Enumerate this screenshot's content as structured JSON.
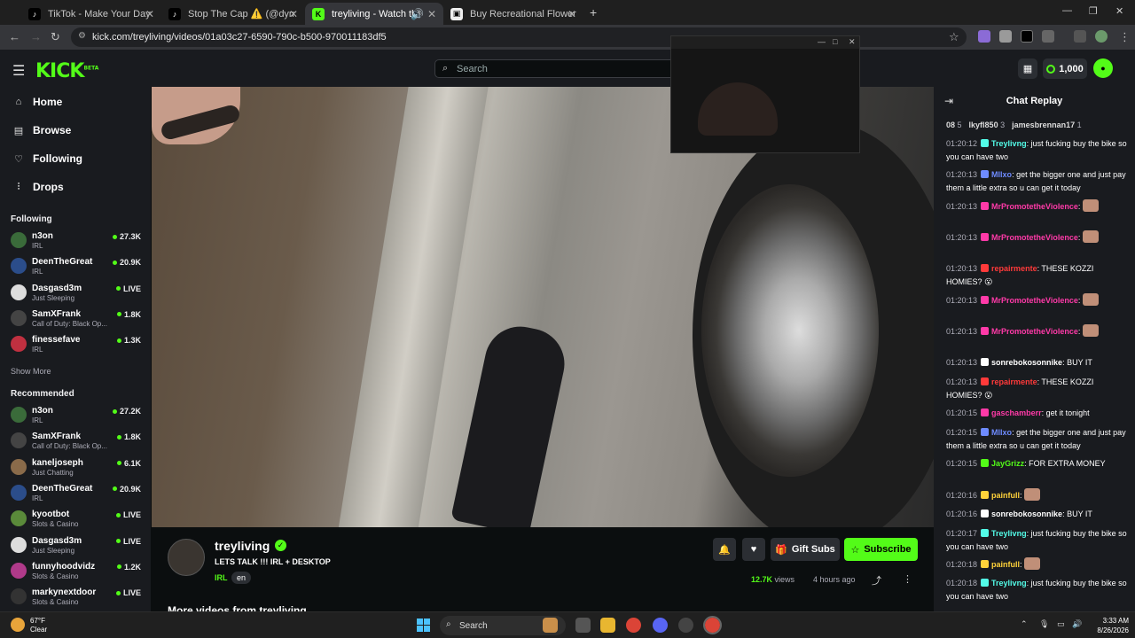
{
  "browser": {
    "tabs": [
      {
        "title": "TikTok - Make Your Day",
        "icon": "tiktok-icon",
        "active": false
      },
      {
        "title": "Stop The Cap ⚠️ (@dymestay...",
        "icon": "tiktok-icon",
        "active": false
      },
      {
        "title": "treyliving - Watch the VOD",
        "icon": "kick-icon",
        "active": true
      },
      {
        "title": "Buy Recreational Flower in Las...",
        "icon": "store-icon",
        "active": false
      }
    ],
    "url": "kick.com/treyliving/videos/01a03c27-6590-790c-b500-970011183df5"
  },
  "header": {
    "logo": "KICK",
    "logo_badge": "BETA",
    "search_placeholder": "Search",
    "credits": "1,000"
  },
  "sidebar": {
    "nav": [
      {
        "label": "Home",
        "icon": "home-icon"
      },
      {
        "label": "Browse",
        "icon": "browse-icon"
      },
      {
        "label": "Following",
        "icon": "heart-icon"
      },
      {
        "label": "Drops",
        "icon": "drops-icon"
      }
    ],
    "following_title": "Following",
    "following": [
      {
        "name": "n3on",
        "category": "IRL",
        "viewers": "27.3K",
        "color": "#3a6b3a"
      },
      {
        "name": "DeenTheGreat",
        "category": "IRL",
        "viewers": "20.9K",
        "color": "#2b4d8a"
      },
      {
        "name": "Dasgasd3m",
        "category": "Just Sleeping",
        "viewers": "LIVE",
        "color": "#ddd"
      },
      {
        "name": "SamXFrank",
        "category": "Call of Duty: Black Op...",
        "viewers": "1.8K",
        "color": "#444"
      },
      {
        "name": "finessefave",
        "category": "IRL",
        "viewers": "1.3K",
        "color": "#c03040"
      }
    ],
    "show_more": "Show More",
    "recommended_title": "Recommended",
    "recommended": [
      {
        "name": "n3on",
        "category": "IRL",
        "viewers": "27.2K",
        "color": "#3a6b3a"
      },
      {
        "name": "SamXFrank",
        "category": "Call of Duty: Black Op...",
        "viewers": "1.8K",
        "color": "#444"
      },
      {
        "name": "kaneljoseph",
        "category": "Just Chatting",
        "viewers": "6.1K",
        "color": "#8a6b4a"
      },
      {
        "name": "DeenTheGreat",
        "category": "IRL",
        "viewers": "20.9K",
        "color": "#2b4d8a"
      },
      {
        "name": "kyootbot",
        "category": "Slots & Casino",
        "viewers": "LIVE",
        "color": "#5a8a3a"
      },
      {
        "name": "Dasgasd3m",
        "category": "Just Sleeping",
        "viewers": "LIVE",
        "color": "#ddd"
      },
      {
        "name": "funnyhoodvidz",
        "category": "Slots & Casino",
        "viewers": "1.2K",
        "color": "#b03a8a"
      },
      {
        "name": "markynextdoor",
        "category": "Slots & Casino",
        "viewers": "LIVE",
        "color": "#333"
      }
    ]
  },
  "video_info": {
    "channel": "treyliving",
    "title": "LETS TALK !!! IRL + DESKTOP",
    "category": "IRL",
    "language": "en",
    "gift_subs": "Gift Subs",
    "subscribe": "Subscribe",
    "views_count": "12.7K",
    "views_label": "views",
    "age": "4 hours ago",
    "more_videos": "More videos from treyliving"
  },
  "chat": {
    "title": "Chat Replay",
    "gifters": [
      {
        "name": "08",
        "count": "5"
      },
      {
        "name": "lkyfl850",
        "count": "3"
      },
      {
        "name": "jamesbrennan17",
        "count": "1"
      }
    ],
    "messages": [
      {
        "time": "01:20:12",
        "user": "Treylivng",
        "color": "#53fce8",
        "text": "just fucking buy the bike so you can have two"
      },
      {
        "time": "01:20:13",
        "user": "Mllxo",
        "color": "#6e8bff",
        "text": "get the bigger one and just pay them a little extra so u can get it today"
      },
      {
        "time": "01:20:13",
        "user": "MrPromotetheViolence",
        "color": "#ff3aa8",
        "text": ""
      },
      {
        "time": "01:20:13",
        "user": "MrPromotetheViolence",
        "color": "#ff3aa8",
        "text": ""
      },
      {
        "time": "01:20:13",
        "user": "repairmente",
        "color": "#ff3a3a",
        "text": "THESE KOZZI HOMIES? 😮"
      },
      {
        "time": "01:20:13",
        "user": "MrPromotetheViolence",
        "color": "#ff3aa8",
        "text": ""
      },
      {
        "time": "01:20:13",
        "user": "MrPromotetheViolence",
        "color": "#ff3aa8",
        "text": ""
      },
      {
        "time": "01:20:13",
        "user": "sonrebokosonnike",
        "color": "#ffffff",
        "text": "BUY IT"
      },
      {
        "time": "01:20:13",
        "user": "repairmente",
        "color": "#ff3a3a",
        "text": "THESE KOZZI HOMIES? 😮"
      },
      {
        "time": "01:20:15",
        "user": "gaschamberr",
        "color": "#ff3aa8",
        "text": "get it tonight"
      },
      {
        "time": "01:20:15",
        "user": "Mllxo",
        "color": "#6e8bff",
        "text": "get the bigger one and just pay them a little extra so u can get it today"
      },
      {
        "time": "01:20:15",
        "user": "JayGrizz",
        "color": "#53fc18",
        "text": "FOR EXTRA MONEY"
      },
      {
        "time": "01:20:16",
        "user": "painfull",
        "color": "#ffd23a",
        "text": ""
      },
      {
        "time": "01:20:16",
        "user": "sonrebokosonnike",
        "color": "#ffffff",
        "text": "BUY IT"
      },
      {
        "time": "01:20:17",
        "user": "Treylivng",
        "color": "#53fce8",
        "text": "just fucking buy the bike so you can have two"
      },
      {
        "time": "01:20:18",
        "user": "painfull",
        "color": "#ffd23a",
        "text": ""
      },
      {
        "time": "01:20:18",
        "user": "Treylivng",
        "color": "#53fce8",
        "text": "just fucking buy the bike so you can have two"
      }
    ]
  },
  "taskbar": {
    "temp": "67°F",
    "weather": "Clear",
    "search": "Search",
    "time": "3:33 AM",
    "date": "8/26/2026"
  }
}
